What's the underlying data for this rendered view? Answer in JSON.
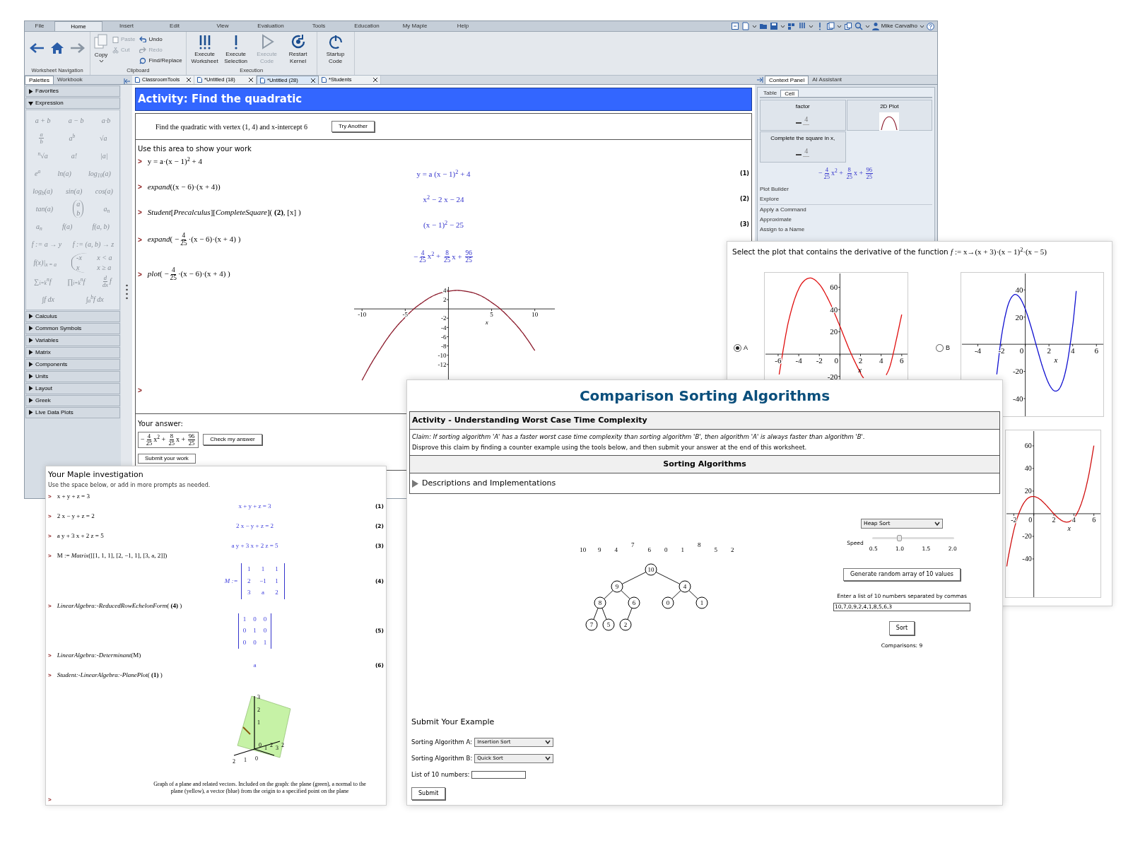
{
  "main_window": {
    "menu_tabs": [
      {
        "label": "File",
        "selected": false
      },
      {
        "label": "Home",
        "selected": true
      },
      {
        "label": "Insert",
        "selected": false
      },
      {
        "label": "Edit",
        "selected": false
      },
      {
        "label": "View",
        "selected": false
      },
      {
        "label": "Evaluation",
        "selected": false
      },
      {
        "label": "Tools",
        "selected": false
      },
      {
        "label": "Education",
        "selected": false
      },
      {
        "label": "My Maple",
        "selected": false
      },
      {
        "label": "Help",
        "selected": false
      }
    ],
    "user": "Mike Carvalho",
    "ribbon": [
      {
        "kind": "nav",
        "label": "Worksheet Navigation"
      },
      {
        "kind": "clipboard",
        "label": "Clipboard",
        "buttons": [
          {
            "label": "Copy",
            "disabled": false
          },
          {
            "label": "Paste",
            "disabled": true
          },
          {
            "label": "Cut",
            "disabled": true
          },
          {
            "label": "Undo",
            "disabled": false
          },
          {
            "label": "Redo",
            "disabled": true
          },
          {
            "label": "Find/Replace",
            "disabled": false
          }
        ]
      },
      {
        "kind": "large",
        "label": "Execution",
        "buttons": [
          {
            "label": "Execute Worksheet",
            "disabled": false
          },
          {
            "label": "Execute Selection",
            "disabled": false
          },
          {
            "label": "Execute Code",
            "disabled": true
          },
          {
            "label": "Restart Kernel",
            "disabled": false
          }
        ]
      },
      {
        "kind": "large",
        "buttons": [
          {
            "label": "Startup Code",
            "disabled": false
          }
        ]
      }
    ],
    "left_tabs": [
      {
        "label": "Palettes",
        "selected": true
      },
      {
        "label": "Workbook",
        "selected": false
      }
    ],
    "doc_tabs": [
      {
        "label": "ClassroomTools",
        "selected": false
      },
      {
        "label": "*Untitled (18)",
        "selected": false
      },
      {
        "label": "*Untitled (28)",
        "selected": true
      },
      {
        "label": "*Students",
        "selected": false
      }
    ],
    "right_tabs": [
      {
        "label": "Context Panel",
        "selected": true
      },
      {
        "label": "AI Assistant",
        "selected": false
      }
    ],
    "palettes": [
      {
        "label": "Favorites",
        "expanded": false
      },
      {
        "label": "Expression",
        "expanded": true,
        "rows": [
          [
            [
              "a + b"
            ],
            [
              "a − b"
            ],
            [
              "a·b"
            ]
          ],
          [
            [
              {
                "num": "a",
                "den": "b"
              }
            ],
            [
              "a$^{b}$"
            ],
            [
              "√a"
            ]
          ],
          [
            [
              "$^{n}$√a"
            ],
            [
              "a!"
            ],
            [
              "|a|"
            ]
          ],
          [
            [
              "e$^{a}$"
            ],
            [
              "ln(a)"
            ],
            [
              "log$_{10}$(a)"
            ]
          ],
          [
            [
              "log$_{b}$(a)"
            ],
            [
              "sin(a)"
            ],
            [
              "cos(a)"
            ]
          ],
          [
            [
              "tan(a)"
            ],
            [
              {
                "kind": "binom",
                "top": "a",
                "bottom": "b"
              }
            ],
            [
              "a$_{n}$"
            ]
          ],
          [
            [
              "a$_{n}$"
            ],
            [
              "f(a)"
            ],
            [
              "f(a, b)"
            ]
          ],
          [
            [
              "f := a → y"
            ],
            [
              "f := (a, b) → z"
            ]
          ],
          [
            [
              "f(x)|$_{x = a}$"
            ],
            [
              {
                "kind": "piecewise",
                "rows": [
                  [
                    "-x",
                    "x < a"
                  ],
                  [
                    "x",
                    "x ≥ a"
                  ]
                ]
              }
            ]
          ],
          [
            [
              "∑$_{i=k}$$^{n}$f"
            ],
            [
              "∏$_{i=k}$$^{n}$f"
            ],
            [
              {
                "num": "d",
                "den": "dx"
              },
              "f"
            ]
          ],
          [
            [
              "∫f dx"
            ],
            [
              "∫$_{a}$$^{b}$f dx"
            ]
          ]
        ]
      },
      {
        "label": "Calculus",
        "expanded": false
      },
      {
        "label": "Common Symbols",
        "expanded": false
      },
      {
        "label": "Variables",
        "expanded": false
      },
      {
        "label": "Matrix",
        "expanded": false
      },
      {
        "label": "Components",
        "expanded": false
      },
      {
        "label": "Units",
        "expanded": false
      },
      {
        "label": "Layout",
        "expanded": false
      },
      {
        "label": "Greek",
        "expanded": false
      },
      {
        "label": "Live Data Plots",
        "expanded": false
      }
    ],
    "worksheet": {
      "banner": "Activity: Find the quadratic",
      "task": "Find the quadratic with vertex (1, 4) and x-intercept 6",
      "task_button": "Try Another",
      "work_heading": "Use this area to show your work",
      "lines": [
        {
          "prompt": ">",
          "input": [
            "y = a·(x − 1)$^{2}$ + 4"
          ],
          "output": {
            "kind": "math",
            "parts": [
              "y = a (x − 1)$^{2}$ + 4"
            ]
          },
          "label": "(1)"
        },
        {
          "prompt": ">",
          "input": [
            "*expand*((x − 6)·(x + 4))"
          ],
          "output": {
            "kind": "math",
            "parts": [
              "x$^{2}$ − 2 x − 24"
            ]
          },
          "label": "(2)"
        },
        {
          "prompt": ">",
          "input": [
            "*Student*[*Precalculus*][*CompleteSquare*]( **(2)**, [x] )"
          ],
          "output": {
            "kind": "math",
            "parts": [
              "(x − 1)$^{2}$ − 25"
            ]
          },
          "label": "(3)"
        },
        {
          "prompt": ">",
          "input": [
            "*expand*( −",
            {
              "num": "4",
              "den": "25"
            },
            "·(x − 6)·(x + 4) )"
          ],
          "output": {
            "kind": "math",
            "parts": [
              "−",
              {
                "num": "4",
                "den": "25"
              },
              "x$^{2}$ + ",
              {
                "num": "8",
                "den": "25"
              },
              "x + ",
              {
                "num": "96",
                "den": "25"
              }
            ]
          }
        },
        {
          "prompt": ">",
          "input": [
            "*plot*( −",
            {
              "num": "4",
              "den": "25"
            },
            "·(x − 6)·(x + 4) )"
          ],
          "output": {
            "kind": "chart",
            "chart_data": {
              "type": "line",
              "xlabel": "x",
              "x": [
                -10,
                -9,
                -8,
                -7,
                -6,
                -5,
                -4,
                -3,
                -2,
                -1,
                0,
                1,
                2,
                3,
                4,
                5,
                6,
                7,
                8,
                9,
                10
              ],
              "series": [
                {
                  "color": "#8b1a2b",
                  "values": [
                    -15.4,
                    -12,
                    -9,
                    -6.2,
                    -3.8,
                    -1.8,
                    0,
                    1.4,
                    2.6,
                    3.4,
                    3.8,
                    4,
                    3.8,
                    3.4,
                    2.6,
                    1.4,
                    0,
                    -1.8,
                    -3.8,
                    -6.2,
                    -9
                  ]
                }
              ],
              "xlim": [
                -11,
                12.4
              ],
              "ylim": [
                -16.3,
                4.9
              ],
              "xticks": [
                -10,
                -5,
                5,
                10
              ],
              "yticks": [
                4,
                2,
                -2,
                -4,
                -6,
                -8,
                -10,
                -12
              ]
            }
          }
        },
        {
          "prompt": ">"
        }
      ],
      "answer_label": "Your answer:",
      "answer": [
        "−",
        {
          "num": "4",
          "den": "25"
        },
        "x$^{2}$ + ",
        {
          "num": "8",
          "den": "25"
        },
        "x + ",
        {
          "num": "96",
          "den": "25"
        }
      ],
      "check_button": "Check my answer",
      "submit_button": "Submit your work"
    },
    "context_panel": {
      "tabs": [
        {
          "label": "Table",
          "selected": false
        },
        {
          "label": "Cell",
          "selected": true
        }
      ],
      "tiles": [
        {
          "kind": "preview",
          "label": "factor",
          "preview": "4"
        },
        {
          "kind": "plot",
          "label": "2D Plot"
        },
        {
          "kind": "preview",
          "label": "Complete the square in x,",
          "preview": "4"
        }
      ],
      "expression": [
        "−",
        {
          "num": "4",
          "den": "25"
        },
        "x$^{2}$ + ",
        {
          "num": "8",
          "den": "25"
        },
        "x + ",
        {
          "num": "96",
          "den": "25"
        }
      ],
      "actions": [
        "Plot Builder",
        "Explore",
        "Apply a Command",
        "Approximate",
        "Assign to a Name"
      ]
    }
  },
  "plot_window": {
    "question": "Select the plot that contains the derivative of the function ",
    "function": [
      "*f* := x→(x + 3)·(x − 1)$^{2}$·(x − 5)"
    ],
    "options": [
      {
        "label": "A",
        "selected": true,
        "chart_data": {
          "type": "line",
          "xlabel": "x",
          "x": [
            -5.9,
            -5,
            -4,
            -3,
            -2,
            -1,
            0,
            1,
            2,
            2.3,
            3,
            4.5,
            5,
            6
          ],
          "series": [
            {
              "color": "#e01010",
              "values": [
                -18.2,
                29.1,
                58.6,
                68.2,
                62.7,
                46.7,
                25,
                2.2,
                -17.1,
                -21.4,
                null,
                -18.7,
                -6.4,
                35.5
              ]
            }
          ],
          "xlim": [
            -7.3,
            6.7
          ],
          "ylim": [
            -57,
            73
          ],
          "xticks": [
            -6,
            -4,
            -2,
            0,
            2,
            4,
            6
          ],
          "yticks": [
            60,
            40,
            20,
            -20
          ]
        }
      },
      {
        "label": "B",
        "selected": false,
        "chart_data": {
          "type": "line",
          "xlabel": "x",
          "x": [
            -2.4,
            -2,
            -1.5,
            -1,
            -0.5,
            0,
            0.5,
            1,
            1.5,
            2,
            2.5,
            3,
            3.5,
            4,
            4.3
          ],
          "series": [
            {
              "color": "#1010d0",
              "values": [
                -22.1,
                6.1,
                27.5,
                36.1,
                34.7,
                25.9,
                12.4,
                -3.1,
                -17.9,
                -29.2,
                -34.4,
                -30.8,
                -15.7,
                13.6,
                39.2
              ]
            }
          ],
          "xlim": [
            -5.4,
            6.7
          ],
          "ylim": [
            -54,
            52.6
          ],
          "xticks": [
            -4,
            -2,
            0,
            2,
            4,
            6
          ],
          "yticks": [
            40,
            20,
            -20,
            -40
          ]
        }
      }
    ],
    "extra_plot": {
      "chart_data": {
        "type": "line",
        "xlabel": "x",
        "x": [
          -2.7,
          -2.5,
          -2,
          -1.5,
          -1,
          -0.5,
          0,
          0.5,
          1,
          1.5,
          2,
          2.5,
          3,
          3.5,
          4,
          4.5,
          5,
          5.5,
          6
        ],
        "series": [
          {
            "color": "#d01010",
            "values": [
              -46.6,
              -36.1,
              -14.9,
              0,
              9.4,
              14.2,
              15.2,
              13.5,
              9.7,
              5,
              0,
              -4.2,
              -6.9,
              -7.1,
              -3.9,
              3.5,
              16.1,
              34.7,
              60.2
            ]
          }
        ],
        "xlim": [
          -2.8,
          6.8
        ],
        "ylim": [
          -75,
          73.7
        ],
        "xticks": [
          -2,
          0,
          2,
          4,
          6
        ],
        "yticks": [
          60,
          40,
          20,
          -20,
          -40
        ]
      }
    }
  },
  "investigation_window": {
    "title": "Your Maple investigation",
    "subtitle": "Use the space below, or add in more prompts as needed.",
    "lines": [
      {
        "prompt": ">",
        "input": [
          "x + y + z = 3"
        ],
        "output": {
          "kind": "math",
          "parts": [
            "x + y + z = 3"
          ]
        },
        "label": "(1)"
      },
      {
        "prompt": ">",
        "input": [
          "2 x − y + z = 2"
        ],
        "output": {
          "kind": "math",
          "parts": [
            "2 x − y + z = 2"
          ]
        },
        "label": "(2)"
      },
      {
        "prompt": ">",
        "input": [
          "a y + 3 x + 2 z = 5"
        ],
        "output": {
          "kind": "math",
          "parts": [
            "a y + 3 x + 2 z = 5"
          ]
        },
        "label": "(3)"
      },
      {
        "prompt": ">",
        "input": [
          "M := *Matrix*([[1, 1, 1], [2, −1, 1], [3, a, 2]])"
        ],
        "output": {
          "kind": "matrix",
          "prefix": "M :=",
          "rows": [
            [
              "1",
              "1",
              "1"
            ],
            [
              "2",
              "−1",
              "1"
            ],
            [
              "3",
              "a",
              "2"
            ]
          ]
        },
        "label": "(4)"
      },
      {
        "prompt": ">",
        "input": [
          "*LinearAlgebra:-ReducedRowEchelonForm*( **(4)** )"
        ],
        "output": {
          "kind": "matrix",
          "rows": [
            [
              "1",
              "0",
              "0"
            ],
            [
              "0",
              "1",
              "0"
            ],
            [
              "0",
              "0",
              "1"
            ]
          ]
        },
        "label": "(5)"
      },
      {
        "prompt": ">",
        "input": [
          "*LinearAlgebra:-Determinant*(M)"
        ],
        "output": {
          "kind": "math",
          "parts": [
            "a"
          ]
        },
        "label": "(6)"
      },
      {
        "prompt": ">",
        "input": [
          "*Student:-LinearAlgebra:-PlanePlot*( **(1)** )"
        ],
        "output": {
          "kind": "plot3d",
          "z_ticks": [
            "3",
            "2",
            "1"
          ],
          "x_ticks": [
            "2",
            "1",
            "0"
          ],
          "y_ticks": [
            "0",
            "1",
            "2",
            "3",
            "2"
          ],
          "caption": "Graph of a plane and related vectors.  Included on the graph: the plane (green), a normal to the plane (yellow), a vector (blue) from the origin to a specified point on the plane"
        }
      },
      {
        "prompt": ">"
      }
    ]
  },
  "sorting_window": {
    "title": "Comparison Sorting Algorithms",
    "activity_heading": "Activity - Understanding Worst Case Time Complexity",
    "claim": "Claim: If sorting algorithm 'A' has a faster worst case time complexity than sorting algorithm 'B', then algorithm 'A' is always faster than algorithm 'B'.",
    "instruction": "Disprove this claim by finding a counter example using the tools below, and then submit your answer at the end of this worksheet.",
    "section_heading": "Sorting Algorithms",
    "collapsible": {
      "label": "Descriptions and Implementations",
      "expanded": false
    },
    "array": [
      {
        "value": "10",
        "raised": false
      },
      {
        "value": "9",
        "raised": false
      },
      {
        "value": "4",
        "raised": false
      },
      {
        "value": "7",
        "raised": true
      },
      {
        "value": "6",
        "raised": false
      },
      {
        "value": "0",
        "raised": false
      },
      {
        "value": "1",
        "raised": false
      },
      {
        "value": "8",
        "raised": true
      },
      {
        "value": "5",
        "raised": false
      },
      {
        "value": "2",
        "raised": false
      }
    ],
    "heap": {
      "value": "10",
      "children": [
        {
          "value": "9",
          "children": [
            {
              "value": "8",
              "children": [
                {
                  "value": "7"
                },
                {
                  "value": "5"
                }
              ]
            },
            {
              "value": "6",
              "children": [
                {
                  "value": "2"
                }
              ]
            }
          ]
        },
        {
          "value": "4",
          "children": [
            {
              "value": "0"
            },
            {
              "value": "1"
            }
          ]
        }
      ]
    },
    "algorithm_select": "Heap Sort",
    "speed": {
      "label": "Speed",
      "ticks": [
        "0.5",
        "1.0",
        "1.5",
        "2.0"
      ],
      "level": 0.333
    },
    "generate_button": "Generate random array of 10 values",
    "list_label": "Enter a list of 10 numbers separated by commas",
    "list_value": "10,7,0,9,2,4,1,8,5,6,3",
    "sort_button": "Sort",
    "comparisons": "Comparisons: 9",
    "submit": {
      "heading": "Submit Your Example",
      "fields": [
        {
          "kind": "select",
          "label": "Sorting Algorithm A:",
          "value": "Insertion Sort"
        },
        {
          "kind": "select",
          "label": "Sorting Algorithm B:",
          "value": "Quick Sort"
        },
        {
          "kind": "text",
          "label": "List of 10 numbers:"
        }
      ],
      "button": "Submit"
    }
  }
}
